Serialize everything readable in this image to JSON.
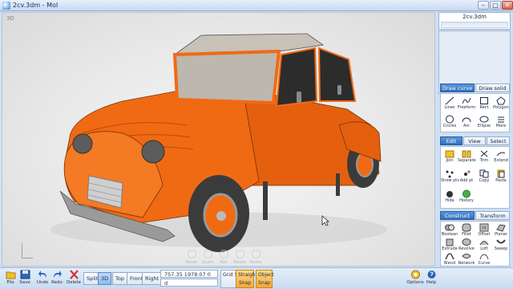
{
  "window": {
    "title": "2cv.3dm - MoI",
    "minimize": "–",
    "maximize": "□",
    "close": "✕"
  },
  "viewport": {
    "label": "3D",
    "nav": [
      {
        "label": "Reset",
        "icon": "reset-icon"
      },
      {
        "label": "Zoom",
        "icon": "zoom-icon"
      },
      {
        "label": "Pan",
        "icon": "pan-icon"
      },
      {
        "label": "Rotate",
        "icon": "rotate-icon"
      },
      {
        "label": "Home",
        "icon": "home-icon"
      }
    ],
    "car_colors": {
      "body": "#f06a14",
      "dark": "#b84a0b",
      "roof": "#d9d2c8",
      "tire": "#3b3b3b",
      "chrome": "#9a9a9a"
    }
  },
  "toolbar": {
    "file": "File",
    "save": "Save",
    "undo": "Undo",
    "redo": "Redo",
    "delete": "Delete",
    "views": [
      "Split",
      "3D",
      "Top",
      "Front",
      "Right"
    ],
    "active_view": "3D",
    "coords": {
      "row1": "757.35    1978.07    0",
      "row2": "d"
    },
    "grid_snap": "Grid Snap",
    "straight_snap": "Straight Snap",
    "object_snap": "Object Snap",
    "options": "Options",
    "help": "Help"
  },
  "panel": {
    "scene_title": "2cv.3dm",
    "draw_tabs": {
      "curve": "Draw curve",
      "solid": "Draw solid"
    },
    "draw_tools": [
      "Lines",
      "Freeform",
      "Rect",
      "Polygon",
      "Circles",
      "Arc",
      "Ellipse",
      "More"
    ],
    "edit_tabs": {
      "edit": "Edit",
      "view": "View",
      "select": "Select"
    },
    "edit_tools": [
      "Join",
      "Separate",
      "Trim",
      "Extend",
      "Show pts",
      "Add pt",
      "Copy",
      "Paste",
      "Hide",
      "History"
    ],
    "construct_tabs": {
      "construct": "Construct",
      "transform": "Transform"
    },
    "construct_tools": [
      "Boolean",
      "Fillet",
      "Offset",
      "Planar",
      "Extrude",
      "Revolve",
      "Loft",
      "Sweep",
      "Blend",
      "Network",
      "Curve"
    ]
  },
  "colors": {
    "accent": "#2f6fbe",
    "snap_active": "#f2a93b",
    "chrome_bg": "#cfe0f3"
  }
}
